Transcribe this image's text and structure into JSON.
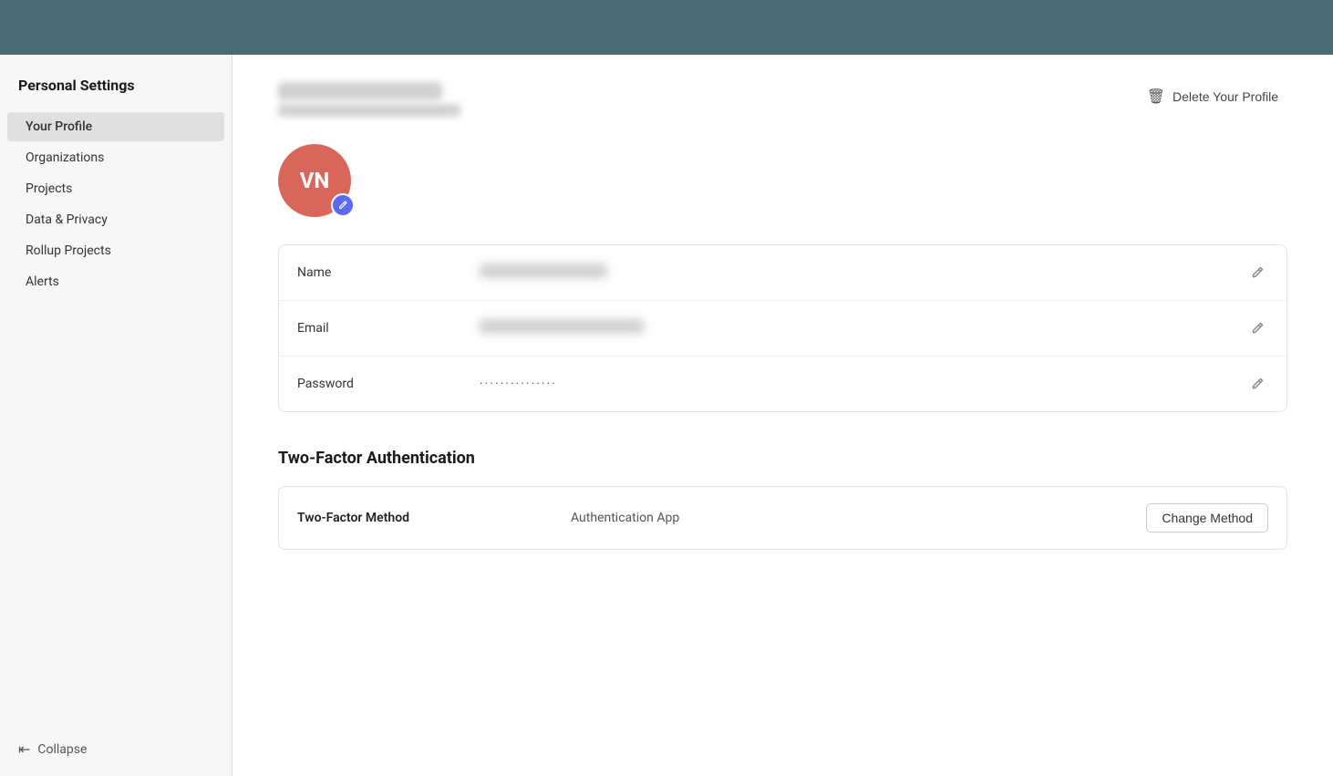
{
  "topBar": {},
  "sidebar": {
    "title": "Personal Settings",
    "items": [
      {
        "id": "your-profile",
        "label": "Your Profile",
        "active": true
      },
      {
        "id": "organizations",
        "label": "Organizations",
        "active": false
      },
      {
        "id": "projects",
        "label": "Projects",
        "active": false
      },
      {
        "id": "data-privacy",
        "label": "Data & Privacy",
        "active": false
      },
      {
        "id": "rollup-projects",
        "label": "Rollup Projects",
        "active": false
      },
      {
        "id": "alerts",
        "label": "Alerts",
        "active": false
      }
    ],
    "collapse_label": "Collapse"
  },
  "main": {
    "delete_button_label": "Delete Your Profile",
    "avatar_initials": "VN",
    "fields": {
      "name_label": "Name",
      "email_label": "Email",
      "password_label": "Password",
      "password_value": "···············"
    },
    "tfa": {
      "section_title": "Two-Factor Authentication",
      "method_label": "Two-Factor Method",
      "method_value": "Authentication App",
      "change_button_label": "Change Method"
    }
  }
}
